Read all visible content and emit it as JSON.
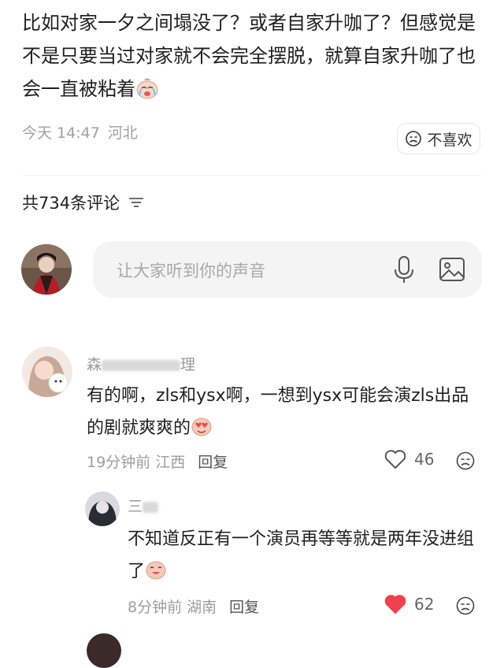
{
  "post": {
    "text": "比如对家一夕之间塌没了？或者自家升咖了？但感觉是不是只要当过对家就不会完全摆脱，就算自家升咖了也会一直被粘着",
    "time": "今天 14:47",
    "location": "河北",
    "dislike_label": "不喜欢"
  },
  "comments_header": {
    "count_label": "共734条评论"
  },
  "comment_input": {
    "placeholder": "让大家听到你的声音"
  },
  "comments": [
    {
      "username_visible": "森",
      "username_tail": "理",
      "text": "有的啊，zls和ysx啊，一想到ysx可能会演zls出品的剧就爽爽的",
      "time": "19分钟前",
      "location": "江西",
      "reply_label": "回复",
      "likes": "46",
      "liked": false
    },
    {
      "username_visible": "三",
      "text": "不知道反正有一个演员再等等就是两年没进组了",
      "time": "8分钟前",
      "location": "湖南",
      "reply_label": "回复",
      "likes": "62",
      "liked": true
    }
  ],
  "colors": {
    "like_active": "#f0414f",
    "input_bg": "#f4f4f4"
  }
}
